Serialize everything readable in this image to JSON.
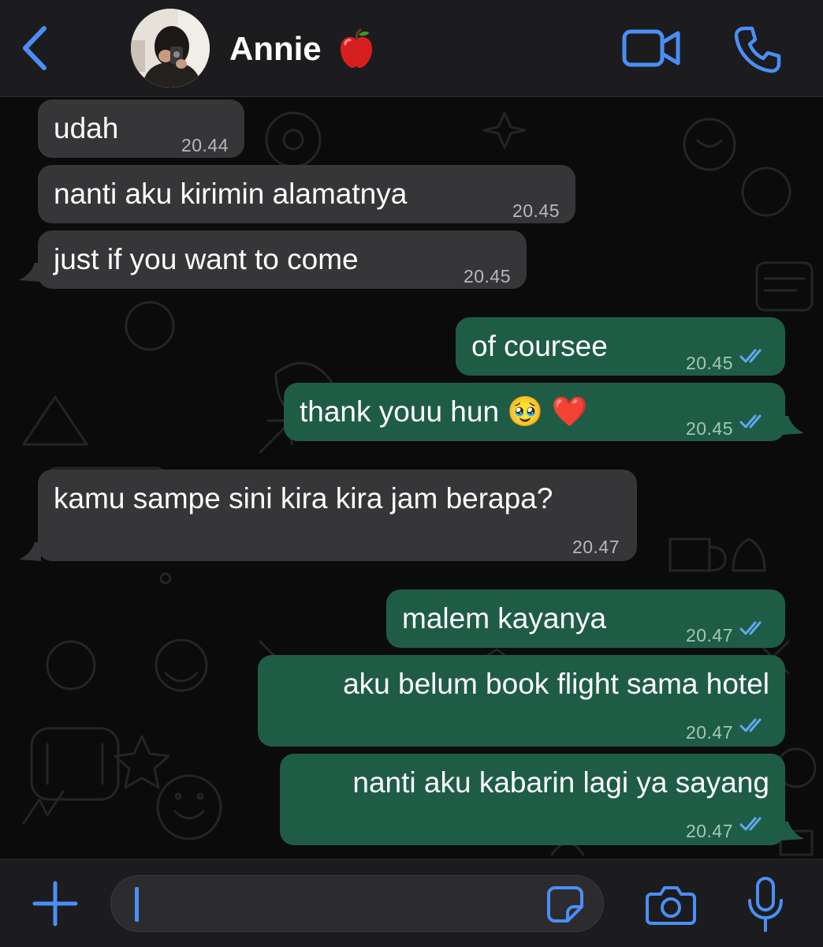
{
  "header": {
    "contact_name": "Annie",
    "name_emoji_icon": "red-apple-icon",
    "back_icon": "chevron-left-icon",
    "video_icon": "video-camera-icon",
    "call_icon": "phone-icon",
    "accent_color": "#4a8ff5"
  },
  "messages": [
    {
      "direction": "incoming",
      "text": "udah",
      "time": "20.44"
    },
    {
      "direction": "incoming",
      "text": "nanti aku kirimin alamatnya",
      "time": "20.45"
    },
    {
      "direction": "incoming",
      "text": "just if you want to come",
      "time": "20.45"
    },
    {
      "direction": "outgoing",
      "text": "of coursee",
      "time": "20.45",
      "status": "read"
    },
    {
      "direction": "outgoing",
      "text": "thank youu hun 🥹 ❤️",
      "time": "20.45",
      "status": "read"
    },
    {
      "direction": "incoming",
      "text": "kamu sampe sini kira kira jam berapa?",
      "time": "20.47"
    },
    {
      "direction": "outgoing",
      "text": "malem kayanya",
      "time": "20.47",
      "status": "read"
    },
    {
      "direction": "outgoing",
      "text": "aku belum book flight sama hotel",
      "time": "20.47",
      "status": "read"
    },
    {
      "direction": "outgoing",
      "text": "nanti aku kabarin lagi ya sayang",
      "time": "20.47",
      "status": "read"
    }
  ],
  "composer": {
    "value": "",
    "placeholder": ""
  },
  "colors": {
    "header_bg": "#1c1c1e",
    "incoming_bubble": "#363638",
    "outgoing_bubble": "#1f5c46",
    "read_ticks": "#5fa8f0"
  }
}
